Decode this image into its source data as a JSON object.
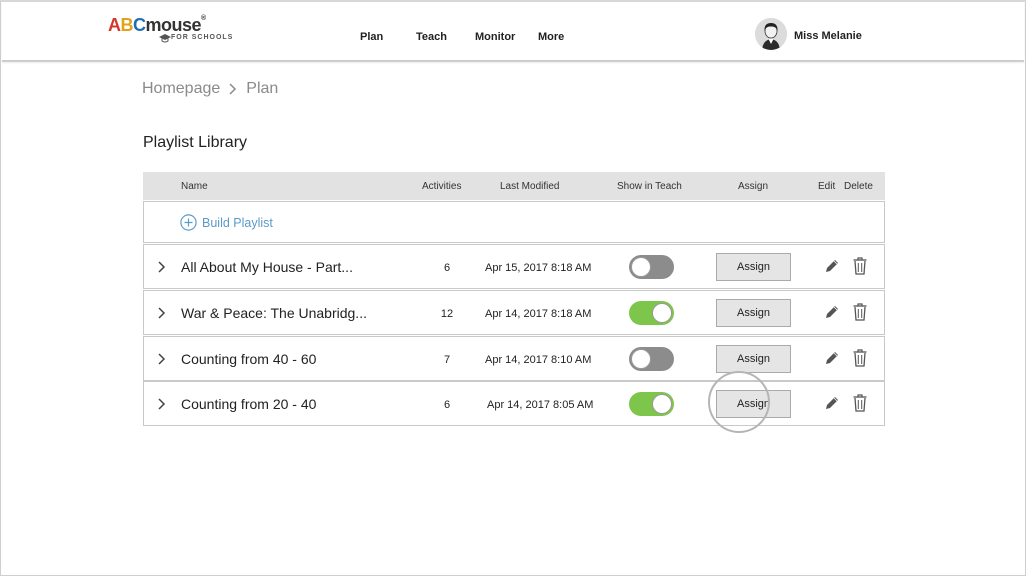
{
  "header": {
    "logo": {
      "a": "A",
      "b": "B",
      "c": "C",
      "rest": "mouse",
      "reg": "®",
      "sub": "FOR SCHOOLS"
    },
    "nav": [
      "Plan",
      "Teach",
      "Monitor",
      "More"
    ],
    "user_name": "Miss Melanie"
  },
  "breadcrumb": [
    "Homepage",
    "Plan"
  ],
  "page_title": "Playlist Library",
  "table": {
    "columns": {
      "name": "Name",
      "activities": "Activities",
      "last_modified": "Last Modified",
      "show_in_teach": "Show in Teach",
      "assign": "Assign",
      "edit": "Edit",
      "delete": "Delete"
    },
    "build_label": "Build Playlist",
    "assign_label": "Assign",
    "rows": [
      {
        "name": "All About My House - Part...",
        "activities": "6",
        "last_modified": "Apr 15, 2017  8:18 AM",
        "show_in_teach": false
      },
      {
        "name": "War & Peace: The Unabridg...",
        "activities": "12",
        "last_modified": "Apr 14, 2017  8:18 AM",
        "show_in_teach": true
      },
      {
        "name": "Counting from 40 - 60",
        "activities": "7",
        "last_modified": "Apr 14, 2017  8:10 AM",
        "show_in_teach": false
      },
      {
        "name": "Counting from 20 - 40",
        "activities": "6",
        "last_modified": "Apr 14, 2017  8:05 AM",
        "show_in_teach": true
      }
    ]
  },
  "colors": {
    "toggle_on": "#7ec54b",
    "toggle_off": "#8c8c8c",
    "link": "#5b9bc8"
  }
}
